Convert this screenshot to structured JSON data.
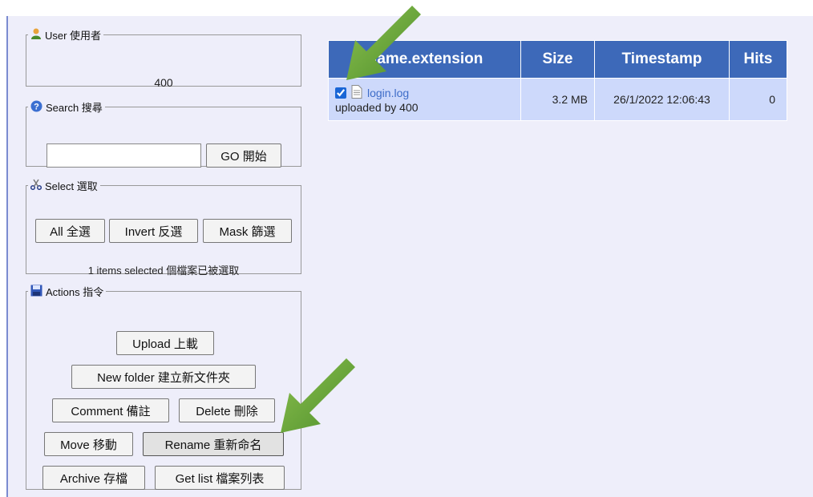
{
  "user": {
    "legend": "User 使用者",
    "value": "400"
  },
  "search": {
    "legend": "Search 搜尋",
    "input_value": "",
    "go_label": "GO 開始"
  },
  "select": {
    "legend": "Select 選取",
    "all_label": "All 全選",
    "invert_label": "Invert 反選",
    "mask_label": "Mask 篩選",
    "status": "1 items selected 個檔案已被選取"
  },
  "actions": {
    "legend": "Actions 指令",
    "upload": "Upload 上載",
    "new_folder": "New folder 建立新文件夾",
    "comment": "Comment 備註",
    "delete": "Delete 刪除",
    "move": "Move 移動",
    "rename": "Rename 重新命名",
    "archive": "Archive 存檔",
    "get_list": "Get list 檔案列表"
  },
  "table": {
    "headers": {
      "name": "Name.extension",
      "size": "Size",
      "timestamp": "Timestamp",
      "hits": "Hits"
    },
    "rows": [
      {
        "name": "login.log",
        "uploader": "uploaded by 400",
        "size": "3.2 MB",
        "timestamp": "26/1/2022 12:06:43",
        "hits": "0",
        "checked": true
      }
    ]
  },
  "colors": {
    "header_bg": "#3d69b9",
    "row_bg": "#cdd9fb",
    "panel_bg": "#eeeefa",
    "arrow": "#6aa63a"
  }
}
